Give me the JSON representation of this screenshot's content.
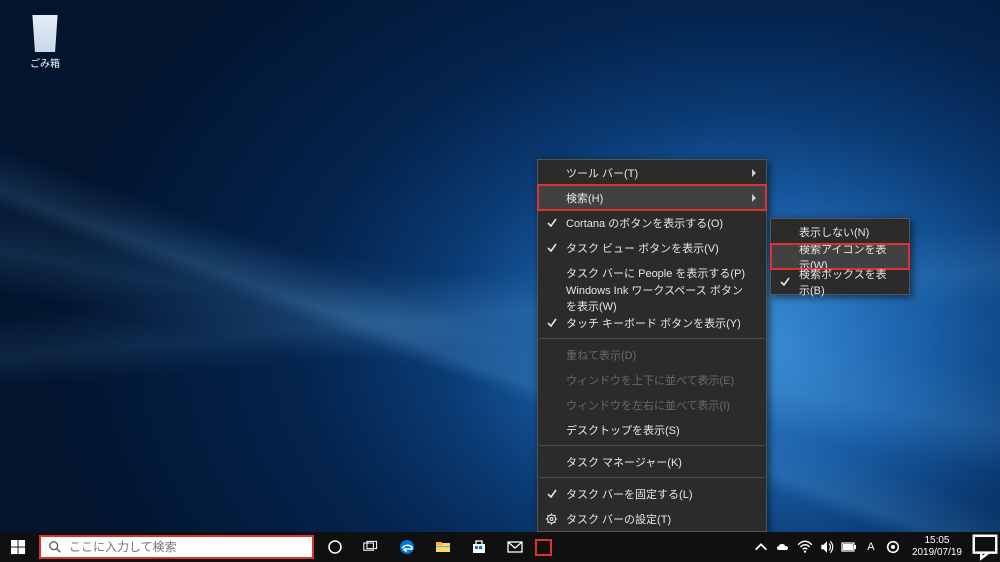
{
  "desktop": {
    "recycle_bin_label": "ごみ箱"
  },
  "taskbar": {
    "search_placeholder": "ここに入力して検索",
    "ime_label": "A",
    "clock_time": "15:05",
    "clock_date": "2019/07/19"
  },
  "context_menu": {
    "items": [
      {
        "label": "ツール バー(T)",
        "submenu": true
      },
      {
        "label": "検索(H)",
        "submenu": true,
        "hovered": true,
        "red": true
      },
      {
        "label": "Cortana のボタンを表示する(O)",
        "checked": true
      },
      {
        "label": "タスク ビュー ボタンを表示(V)",
        "checked": true
      },
      {
        "label": "タスク バーに People を表示する(P)"
      },
      {
        "label": "Windows Ink ワークスペース ボタンを表示(W)"
      },
      {
        "label": "タッチ キーボード ボタンを表示(Y)",
        "checked": true
      },
      {
        "sep": true
      },
      {
        "label": "重ねて表示(D)",
        "disabled": true
      },
      {
        "label": "ウィンドウを上下に並べて表示(E)",
        "disabled": true
      },
      {
        "label": "ウィンドウを左右に並べて表示(I)",
        "disabled": true
      },
      {
        "label": "デスクトップを表示(S)"
      },
      {
        "sep": true
      },
      {
        "label": "タスク マネージャー(K)"
      },
      {
        "sep": true
      },
      {
        "label": "タスク バーを固定する(L)",
        "checked": true
      },
      {
        "label": "タスク バーの設定(T)",
        "gear": true
      }
    ]
  },
  "sub_menu": {
    "items": [
      {
        "label": "表示しない(N)"
      },
      {
        "label": "検索アイコンを表示(W)",
        "hovered": true,
        "red": true
      },
      {
        "label": "検索ボックスを表示(B)",
        "checked": true
      }
    ]
  }
}
